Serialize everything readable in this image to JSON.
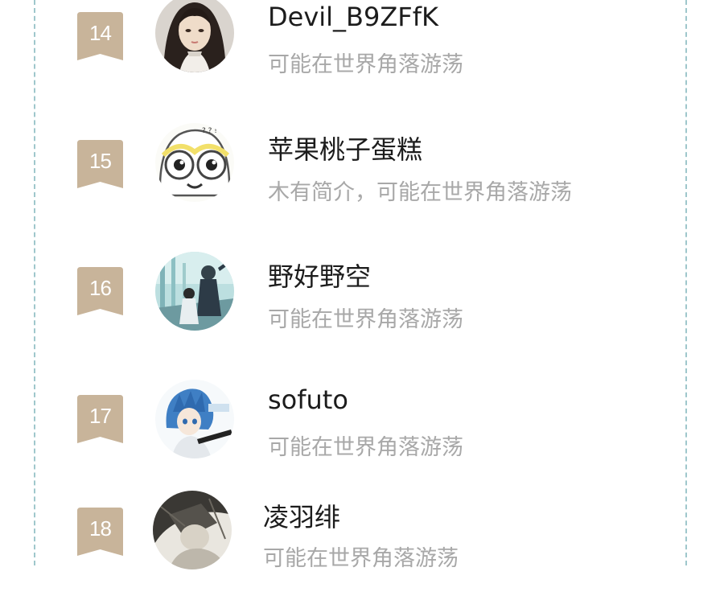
{
  "colors": {
    "rank_badge": "#c8b49a",
    "dashed_border": "#9fc7cc",
    "name_text": "#1c1c1c",
    "bio_text": "#a8a8a8"
  },
  "users": [
    {
      "rank": "14",
      "name": "Devil_B9ZFfK",
      "bio": "可能在世界角落游荡",
      "avatar": "portrait-avatar"
    },
    {
      "rank": "15",
      "name": "苹果桃子蛋糕",
      "bio": "木有简介，可能在世界角落游荡",
      "avatar": "cartoon-face-avatar"
    },
    {
      "rank": "16",
      "name": "野好野空",
      "bio": "可能在世界角落游荡",
      "avatar": "anime-scene-avatar"
    },
    {
      "rank": "17",
      "name": "sofuto",
      "bio": "可能在世界角落游荡",
      "avatar": "anime-boy-avatar"
    },
    {
      "rank": "18",
      "name": "凌羽绯",
      "bio": "可能在世界角落游荡",
      "avatar": "sketch-avatar"
    }
  ]
}
